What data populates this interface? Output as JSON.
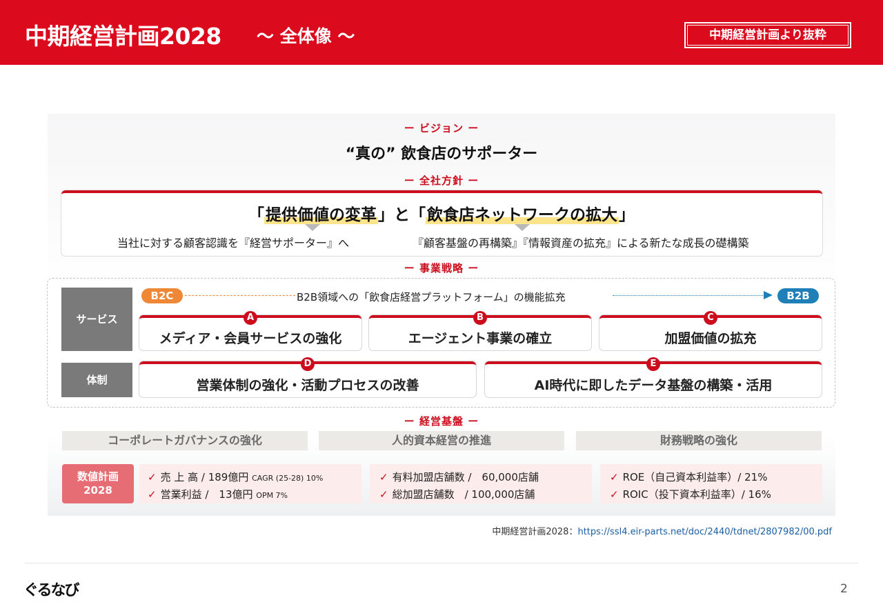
{
  "header": {
    "title": "中期経営計画2028",
    "subtitle": "〜 全体像 〜",
    "badge": "中期経営計画より抜粋"
  },
  "vision": {
    "label": "ー ビジョン ー",
    "text": "“真の” 飲食店のサポーター"
  },
  "policy": {
    "label": "ー 全社方針 ー",
    "main_open": "「",
    "main_hl1": "提供価値の変革",
    "main_mid": "」と「",
    "main_hl2": "飲食店ネットワークの拡大",
    "main_close": "」",
    "sub_left": "当社に対する顧客認識を『経営サポーター』へ",
    "sub_right": "『顧客基盤の再構築』『情報資産の拡充』による新たな成長の礎構築"
  },
  "strategy": {
    "label": "ー 事業戦略 ー",
    "service_label": "サービス",
    "structure_label": "体制",
    "b2c": "B2C",
    "b2b": "B2B",
    "arrow_text": "B2B領域への「飲食店経営プラットフォーム」の機能拡充",
    "cards": [
      {
        "letter": "A",
        "text": "メディア・会員サービスの強化"
      },
      {
        "letter": "B",
        "text": "エージェント事業の確立"
      },
      {
        "letter": "C",
        "text": "加盟価値の拡充"
      },
      {
        "letter": "D",
        "text": "営業体制の強化・活動プロセスの改善"
      },
      {
        "letter": "E",
        "text": "AI時代に即したデータ基盤の構築・活用"
      }
    ]
  },
  "foundation": {
    "label": "ー 経営基盤 ー",
    "items": [
      "コーポレートガバナンスの強化",
      "人的資本経営の推進",
      "財務戦略の強化"
    ]
  },
  "numbers": {
    "head_line1": "数値計画",
    "head_line2": "2028",
    "check": "✓",
    "col1": [
      {
        "text": "売 上 高 / 189億円",
        "note": "CAGR (25-28) 10%"
      },
      {
        "text": "営業利益 /　13億円",
        "note": "OPM 7%"
      }
    ],
    "col2": [
      {
        "text": "有料加盟店舗数 /　60,000店舗"
      },
      {
        "text": "総加盟店舗数　/ 100,000店舗"
      }
    ],
    "col3": [
      {
        "text": "ROE（自己資本利益率）/ 21%"
      },
      {
        "text": "ROIC（投下資本利益率）/ 16%"
      }
    ]
  },
  "source": {
    "prefix": "中期経営計画2028：",
    "url": "https://ssl4.eir-parts.net/doc/2440/tdnet/2807982/00.pdf"
  },
  "footer": {
    "logo": "ぐるなび",
    "page": "2"
  },
  "colors": {
    "brand_red": "#db0a1d",
    "b2c_orange": "#ee8736",
    "b2b_blue": "#1f80b8"
  }
}
